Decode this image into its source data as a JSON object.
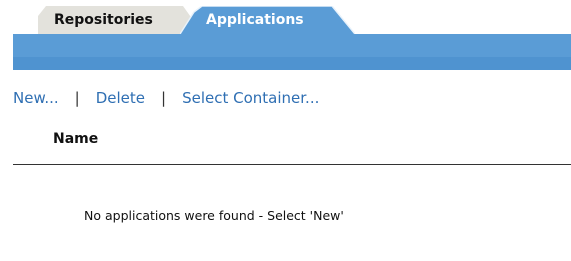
{
  "tabs": [
    {
      "label": "Repositories",
      "active": false
    },
    {
      "label": "Applications",
      "active": true
    }
  ],
  "actions": {
    "new_label": "New...",
    "delete_label": "Delete",
    "select_container_label": "Select Container...",
    "separator": "|"
  },
  "table": {
    "columns": [
      "Name"
    ],
    "empty_message": "No applications were found - Select 'New'"
  },
  "colors": {
    "accent": "#5a9cd6",
    "link": "#2f6fb3",
    "inactive_tab": "#e3e2dc"
  }
}
